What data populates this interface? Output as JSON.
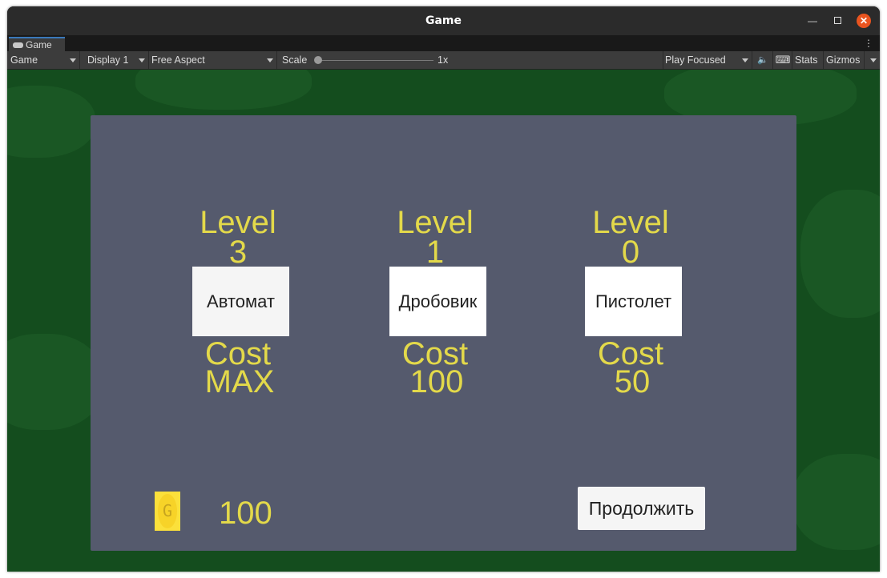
{
  "window": {
    "title": "Game"
  },
  "tabs": [
    {
      "label": "Game"
    }
  ],
  "toolbar": {
    "view_mode": "Game",
    "display": "Display 1",
    "aspect": "Free Aspect",
    "scale_label": "Scale",
    "scale_value": "1x",
    "play_mode": "Play Focused",
    "stats": "Stats",
    "gizmos": "Gizmos"
  },
  "shop": {
    "weapons": [
      {
        "level_label": "Level",
        "level": "3",
        "name": "Автомат",
        "cost_label": "Cost",
        "cost": "MAX"
      },
      {
        "level_label": "Level",
        "level": "1",
        "name": "Дробовик",
        "cost_label": "Cost",
        "cost": "100"
      },
      {
        "level_label": "Level",
        "level": "0",
        "name": "Пистолет",
        "cost_label": "Cost",
        "cost": "50"
      }
    ],
    "coin_letter": "G",
    "money": "100",
    "continue_label": "Продолжить"
  }
}
